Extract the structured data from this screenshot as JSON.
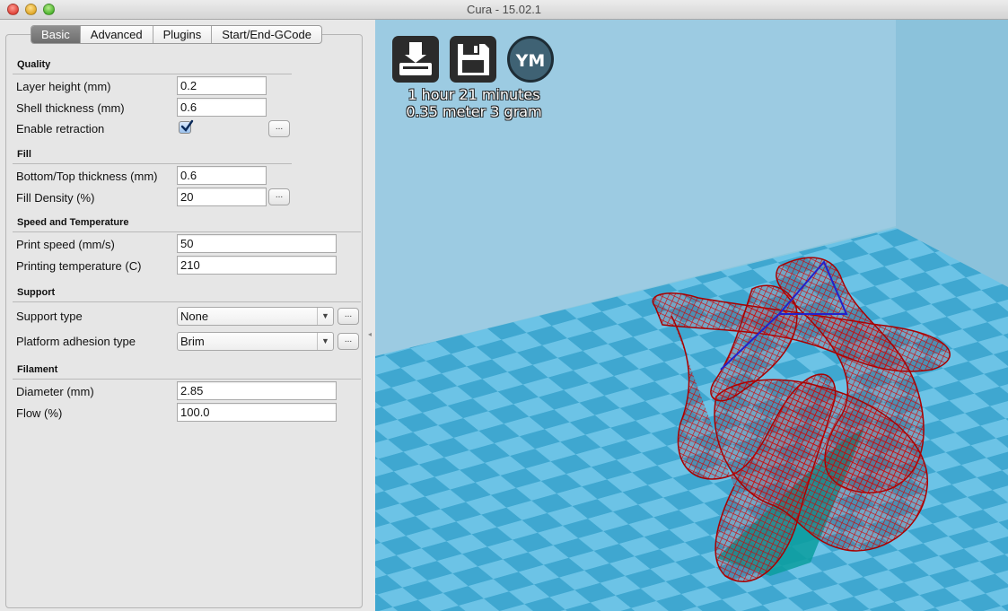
{
  "window": {
    "title": "Cura - 15.02.1"
  },
  "tabs": [
    {
      "label": "Basic",
      "active": true
    },
    {
      "label": "Advanced",
      "active": false
    },
    {
      "label": "Plugins",
      "active": false
    },
    {
      "label": "Start/End-GCode",
      "active": false
    }
  ],
  "quality": {
    "section": "Quality",
    "layer_height_label": "Layer height (mm)",
    "layer_height": "0.2",
    "shell_thickness_label": "Shell thickness (mm)",
    "shell_thickness": "0.6",
    "retraction_label": "Enable retraction",
    "retraction_checked": true,
    "more": "..."
  },
  "fill": {
    "section": "Fill",
    "bottom_top_label": "Bottom/Top thickness (mm)",
    "bottom_top": "0.6",
    "density_label": "Fill Density (%)",
    "density": "20",
    "more": "..."
  },
  "speed": {
    "section": "Speed and Temperature",
    "print_speed_label": "Print speed (mm/s)",
    "print_speed": "50",
    "temp_label": "Printing temperature (C)",
    "temp": "210"
  },
  "support": {
    "section": "Support",
    "type_label": "Support type",
    "type": "None",
    "adhesion_label": "Platform adhesion type",
    "adhesion": "Brim",
    "more": "..."
  },
  "filament": {
    "section": "Filament",
    "diameter_label": "Diameter (mm)",
    "diameter": "2.85",
    "flow_label": "Flow (%)",
    "flow": "100.0"
  },
  "viewport": {
    "print_time": "1 hour 21 minutes",
    "print_material": "0.35 meter 3 gram",
    "ym_label": "YM",
    "colors": {
      "model": "#d40000",
      "support": "#00a3a3",
      "platform_light": "#6ec4e6",
      "platform_dark": "#3fa7d0",
      "wall": "#9ccbe2"
    }
  }
}
